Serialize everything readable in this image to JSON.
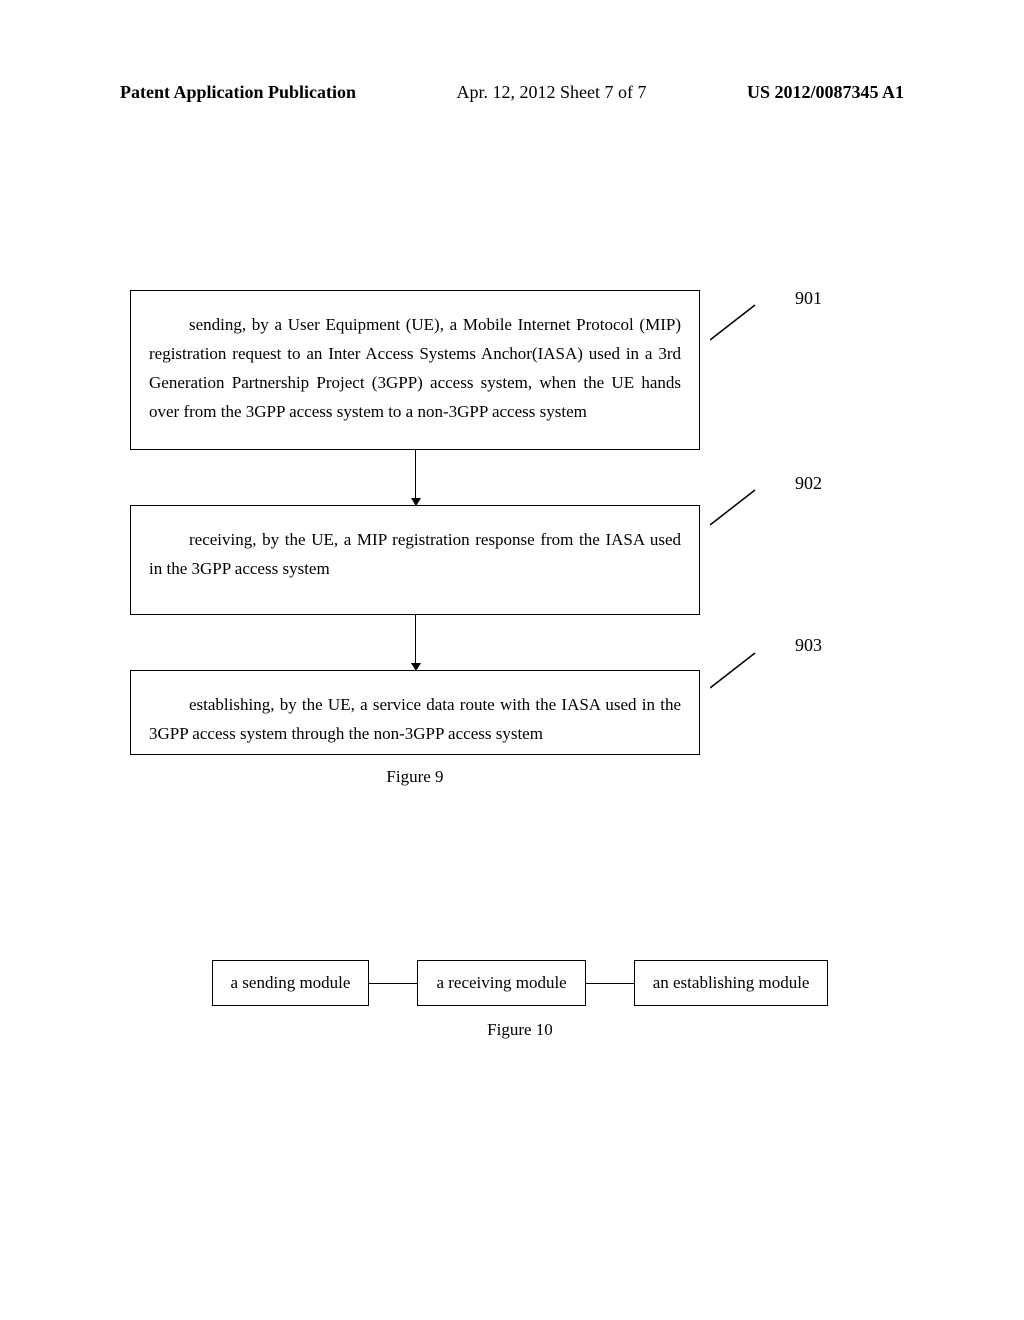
{
  "header": {
    "left": "Patent Application Publication",
    "center": "Apr. 12, 2012  Sheet 7 of 7",
    "right": "US 2012/0087345 A1"
  },
  "figure9": {
    "step901": {
      "text": "sending, by a User Equipment (UE), a Mobile Internet Protocol (MIP) registration request to an Inter Access Systems Anchor(IASA) used in a 3rd Generation Partnership Project (3GPP) access system, when the UE hands over from the 3GPP access system to a non-3GPP access system",
      "ref": "901"
    },
    "step902": {
      "text": "receiving, by the UE, a MIP registration response from the IASA used in the 3GPP access system",
      "ref": "902"
    },
    "step903": {
      "text": "establishing, by the UE, a service data route with the IASA used in the 3GPP access system through the non-3GPP access system",
      "ref": "903"
    },
    "caption": "Figure 9"
  },
  "figure10": {
    "module1": "a sending module",
    "module2": "a receiving module",
    "module3": "an establishing module",
    "caption": "Figure 10"
  }
}
